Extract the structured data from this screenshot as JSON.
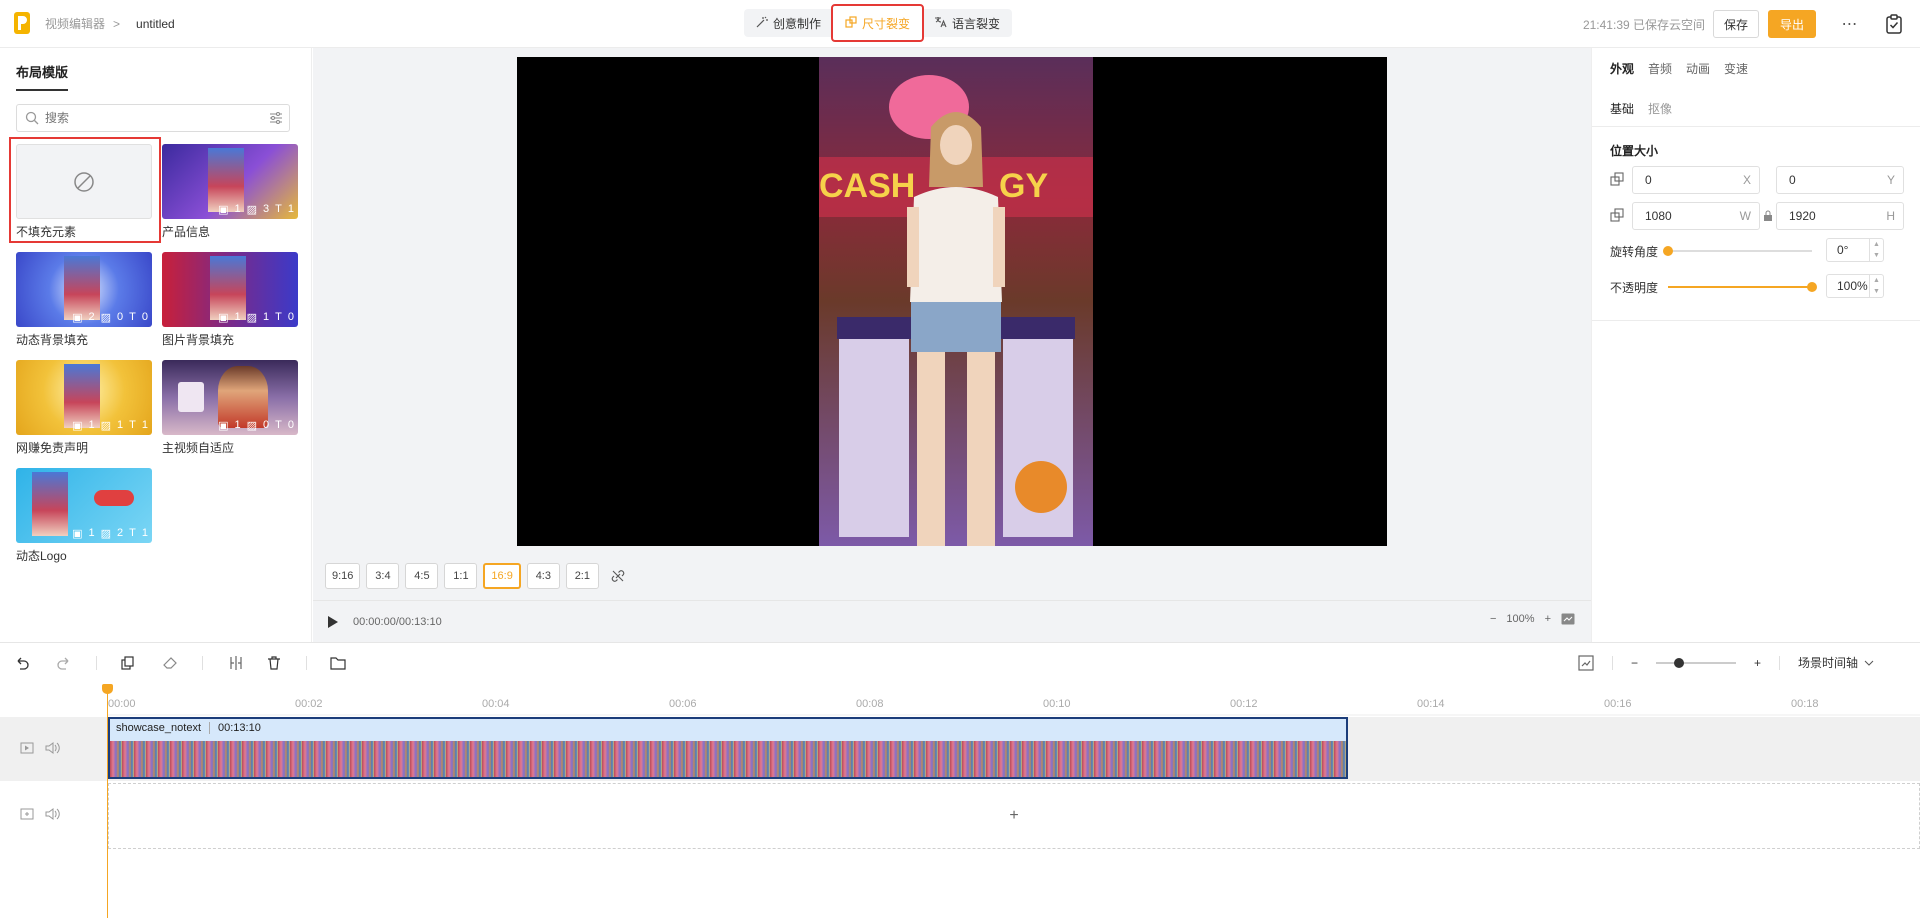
{
  "header": {
    "breadcrumb_parent": "视频编辑器",
    "breadcrumb_sep": ">",
    "title": "untitled",
    "modes": [
      {
        "label": "创意制作",
        "icon": "magic-wand-icon"
      },
      {
        "label": "尺寸裂变",
        "icon": "resize-icon",
        "active": true
      },
      {
        "label": "语言裂变",
        "icon": "translate-icon"
      }
    ],
    "saved_status": "21:41:39 已保存云空间",
    "save_label": "保存",
    "export_label": "导出",
    "more_label": "⋯"
  },
  "left_panel": {
    "tab_label": "布局模版",
    "search_placeholder": "搜索",
    "templates": [
      {
        "label": "不填充元素",
        "counts": null
      },
      {
        "label": "产品信息",
        "counts": [
          "1",
          "3",
          "1"
        ]
      },
      {
        "label": "动态背景填充",
        "counts": [
          "2",
          "0",
          "0"
        ]
      },
      {
        "label": "图片背景填充",
        "counts": [
          "1",
          "1",
          "0"
        ]
      },
      {
        "label": "网赚免责声明",
        "counts": [
          "1",
          "1",
          "1"
        ]
      },
      {
        "label": "主视频自适应",
        "counts": [
          "1",
          "0",
          "0"
        ]
      },
      {
        "label": "动态Logo",
        "counts": [
          "1",
          "2",
          "1"
        ]
      }
    ]
  },
  "preview": {
    "ratios": [
      "9:16",
      "3:4",
      "4:5",
      "1:1",
      "16:9",
      "4:3",
      "2:1"
    ],
    "active_ratio": "16:9",
    "time": "00:00:00/00:13:10",
    "zoom_minus": "−",
    "zoom": "100%",
    "zoom_plus": "+"
  },
  "right_panel": {
    "tabs": [
      "外观",
      "音频",
      "动画",
      "变速"
    ],
    "subtabs": [
      "基础",
      "抠像"
    ],
    "section_title": "位置大小",
    "x_value": "0",
    "x_unit": "X",
    "y_value": "0",
    "y_unit": "Y",
    "w_value": "1080",
    "w_unit": "W",
    "h_value": "1920",
    "h_unit": "H",
    "rotation_label": "旋转角度",
    "rotation_value": "0°",
    "rotation_level": 0,
    "opacity_label": "不透明度",
    "opacity_value": "100%",
    "opacity_level": 1.0
  },
  "timeline": {
    "view_label": "场景时间轴",
    "ruler": [
      "00:00",
      "00:02",
      "00:04",
      "00:06",
      "00:08",
      "00:10",
      "00:12",
      "00:14",
      "00:16",
      "00:18"
    ],
    "clip_name": "showcase_notext",
    "clip_duration": "00:13:10",
    "add_label": "+",
    "zoom_minus": "−",
    "zoom_plus": "+"
  }
}
